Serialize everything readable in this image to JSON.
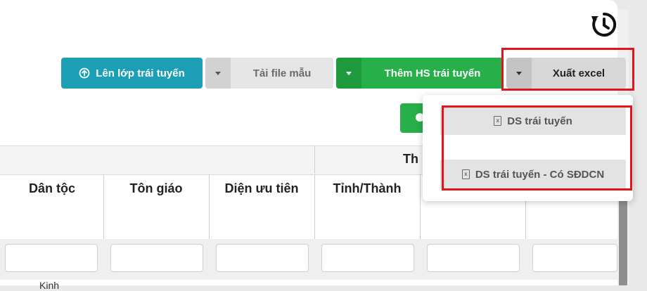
{
  "toolbar": {
    "promote_label": "Lên lớp trái tuyến",
    "download_template_label": "Tải file mẫu",
    "add_student_label": "Thêm HS trái tuyến",
    "export_excel_label": "Xuất excel"
  },
  "export_menu": {
    "items": [
      {
        "label": "DS trái tuyến",
        "icon": "excel-file-icon"
      },
      {
        "label": "DS trái tuyến - Có SĐDCN",
        "icon": "excel-file-icon"
      }
    ]
  },
  "table": {
    "group_header": "Th",
    "columns": [
      "Dân tộc",
      "Tôn giáo",
      "Diện ưu tiên",
      "Tỉnh/Thành"
    ],
    "first_row_value": "Kinh"
  },
  "colors": {
    "teal": "#1c9fb5",
    "green": "#27b04a",
    "highlight_red": "#e3141b"
  },
  "icons": {
    "history": "history-icon",
    "upload": "circle-arrow-up-icon"
  }
}
